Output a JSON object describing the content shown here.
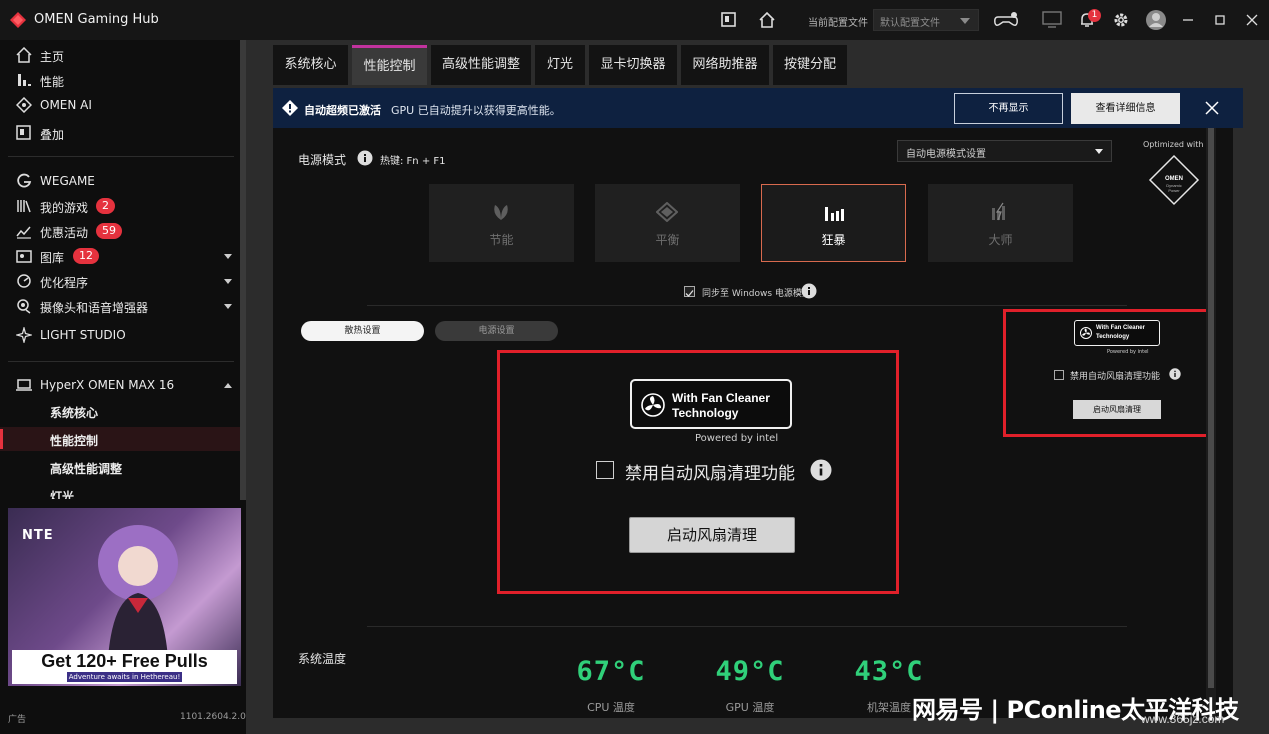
{
  "app": {
    "title": "OMEN Gaming Hub",
    "profile_label": "当前配置文件",
    "profile_value": "默认配置文件",
    "notification_count": "1",
    "brand_color": "#e5323e"
  },
  "sidebar": {
    "items": [
      {
        "label": "主页",
        "icon": "home-icon"
      },
      {
        "label": "性能",
        "icon": "performance-icon"
      },
      {
        "label": "OMEN AI",
        "icon": "omen-ai-icon"
      },
      {
        "label": "叠加",
        "icon": "overlay-icon"
      },
      {
        "label": "WEGAME",
        "icon": "wegame-icon"
      },
      {
        "label": "我的游戏",
        "icon": "library-icon",
        "count": "2"
      },
      {
        "label": "优惠活动",
        "icon": "deals-icon",
        "count": "59"
      },
      {
        "label": "图库",
        "icon": "gallery-icon",
        "count": "12"
      },
      {
        "label": "优化程序",
        "icon": "optimizer-icon"
      },
      {
        "label": "摄像头和语音增强器",
        "icon": "camera-icon"
      },
      {
        "label": "LIGHT STUDIO",
        "icon": "light-studio-icon"
      }
    ],
    "device": {
      "label": "HyperX OMEN MAX 16"
    },
    "sub_items": [
      "系统核心",
      "性能控制",
      "高级性能调整",
      "灯光"
    ],
    "ad": {
      "brand": "NTE",
      "cta": "Get 120+ Free Pulls",
      "cta_sub": "Adventure awaits in Hethereau!"
    },
    "ad_label": "广告",
    "version": "1101.2604.2.0"
  },
  "tabs": [
    "系统核心",
    "性能控制",
    "高级性能调整",
    "灯光",
    "显卡切换器",
    "网络助推器",
    "按键分配"
  ],
  "banner": {
    "title": "自动超频已激活",
    "message": "GPU 已自动提升以获得更高性能。",
    "dismiss": "不再显示",
    "details": "查看详细信息"
  },
  "power": {
    "label": "电源模式",
    "hotkey": "热键: Fn + F1",
    "select_value": "自动电源模式设置",
    "optimized_with": "Optimized with",
    "modes": [
      {
        "label": "节能",
        "icon": "leaf-icon",
        "active": false
      },
      {
        "label": "平衡",
        "icon": "balance-icon",
        "active": false
      },
      {
        "label": "狂暴",
        "icon": "bars-icon",
        "active": true
      },
      {
        "label": "大师",
        "icon": "master-icon",
        "active": false
      }
    ],
    "sync_label": "同步至 Windows 电源模式"
  },
  "subtabs": {
    "cooling": "散热设置",
    "power": "电源设置"
  },
  "fan_cleaner": {
    "logo_line1": "With Fan Cleaner",
    "logo_line2": "Technology",
    "powered_by": "Powered by intel",
    "disable_label": "禁用自动风扇清理功能",
    "start_button": "启动风扇清理"
  },
  "temps": {
    "label": "系统温度",
    "items": [
      {
        "value": "67°C",
        "label": "CPU 温度"
      },
      {
        "value": "49°C",
        "label": "GPU 温度"
      },
      {
        "value": "43°C",
        "label": "机架温度"
      }
    ]
  },
  "watermark": {
    "text": "网易号 | PConline太平洋科技",
    "url": "www.365jz.com"
  }
}
